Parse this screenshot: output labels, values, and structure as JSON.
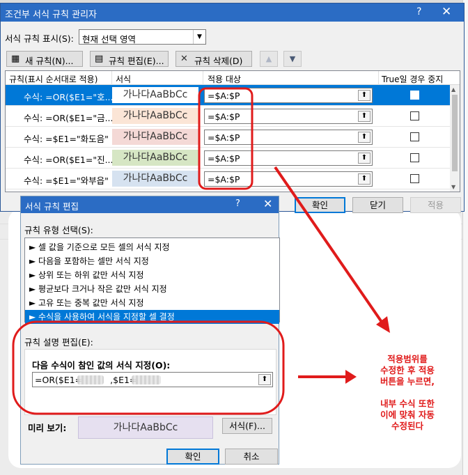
{
  "main_dialog": {
    "title": "조건부 서식 규칙 관리자",
    "help": "?",
    "close": "✕",
    "show_rules_label": "서식 규칙 표시(S):",
    "show_rules_value": "현재 선택 영역",
    "new_rule": "새 규칙(N)...",
    "edit_rule": "규칙 편집(E)...",
    "delete_rule": "규칙 삭제(D)",
    "move_up": "▲",
    "move_down": "▼",
    "columns": {
      "rule": "규칙(표시 순서대로 적용)",
      "format": "서식",
      "applies_to": "적용 대상",
      "stop_if_true": "True일 경우 중지"
    },
    "rows": [
      {
        "condition": "수식: =OR($E1=\"호...",
        "format_sample": "가나다AaBbCc",
        "applies_to": "=$A:$P",
        "format_bg": "#ffffff",
        "selected": true
      },
      {
        "condition": "수식: =OR($E1=\"금...",
        "format_sample": "가나다AaBbCc",
        "applies_to": "=$A:$P",
        "format_bg": "#fbe5d6",
        "selected": false
      },
      {
        "condition": "수식: =$E1=\"화도음\"",
        "format_sample": "가나다AaBbCc",
        "applies_to": "=$A:$P",
        "format_bg": "#f4d9d6",
        "selected": false
      },
      {
        "condition": "수식: =OR($E1=\"진...",
        "format_sample": "가나다AaBbCc",
        "applies_to": "=$A:$P",
        "format_bg": "#d6e6c4",
        "selected": false
      },
      {
        "condition": "수식: =$E1=\"와부읍\"",
        "format_sample": "가나다AaBbCc",
        "applies_to": "=$A:$P",
        "format_bg": "#d6e2f0",
        "selected": false
      }
    ],
    "ok": "확인",
    "close_btn": "닫기",
    "apply": "적용"
  },
  "edit_dialog": {
    "title": "서식 규칙 편집",
    "help": "?",
    "close": "✕",
    "rule_type_label": "규칙 유형 선택(S):",
    "rule_types": [
      "► 셀 값을 기준으로 모든 셀의 서식 지정",
      "► 다음을 포함하는 셀만 서식 지정",
      "► 상위 또는 하위 값만 서식 지정",
      "► 평균보다 크거나 작은 값만 서식 지정",
      "► 고유 또는 중복 값만 서식 지정",
      "► 수식을 사용하여 서식을 지정할 셀 결정"
    ],
    "selected_type_index": 5,
    "description_label": "규칙 설명 편집(E):",
    "formula_label": "다음 수식이 참인 값의 서식 지정(O):",
    "formula_part1": "=OR($E1=",
    "formula_part2": ",$E1=",
    "preview_label": "미리 보기:",
    "preview_sample": "가나다AaBbCc",
    "format_button": "서식(F)...",
    "ok": "확인",
    "cancel": "취소"
  },
  "annotation": {
    "lines": [
      "적용범위를",
      "수정한 후 적용",
      "버튼을 누르면,",
      "",
      "내부 수식 또한",
      "이에 맞춰 자동",
      "수정된다"
    ],
    "color": "#e01b1b"
  },
  "icons": {
    "upload": "⬆",
    "dropdown": "▼",
    "checkbox": "☐"
  }
}
